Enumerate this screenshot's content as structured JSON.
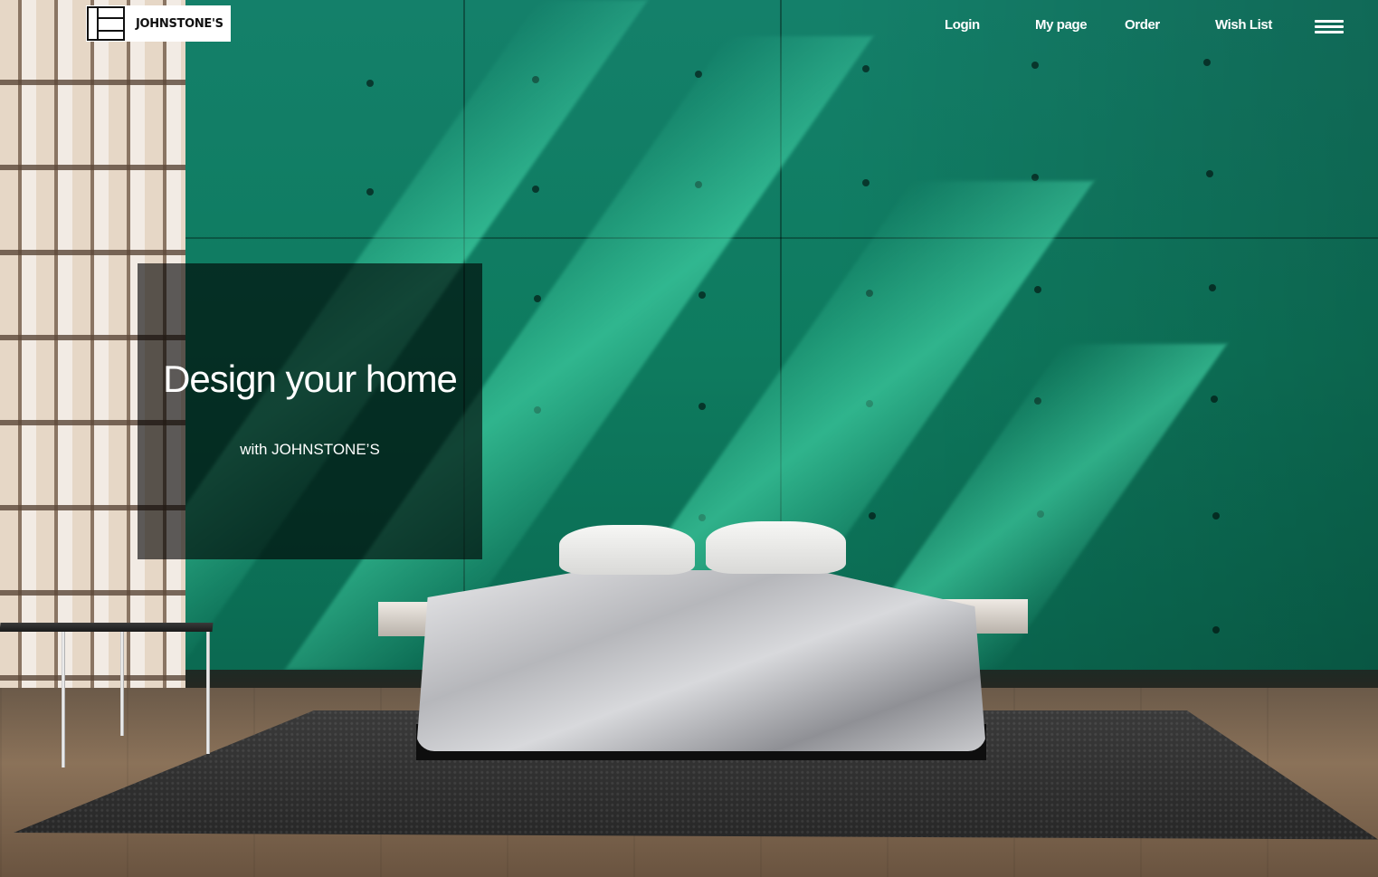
{
  "brand": {
    "logo_text": "JOHNSTONE'S"
  },
  "nav": {
    "items": [
      {
        "label": "Login"
      },
      {
        "label": "My page"
      },
      {
        "label": "Order"
      },
      {
        "label": "Wish List"
      }
    ],
    "menu_icon": "hamburger-menu-icon"
  },
  "hero": {
    "title": "Design your home",
    "subtitle": "with JOHNSTONE’S",
    "wall_color": "#0e7b5f",
    "caption_bg": "rgba(0,0,0,0.62)"
  }
}
